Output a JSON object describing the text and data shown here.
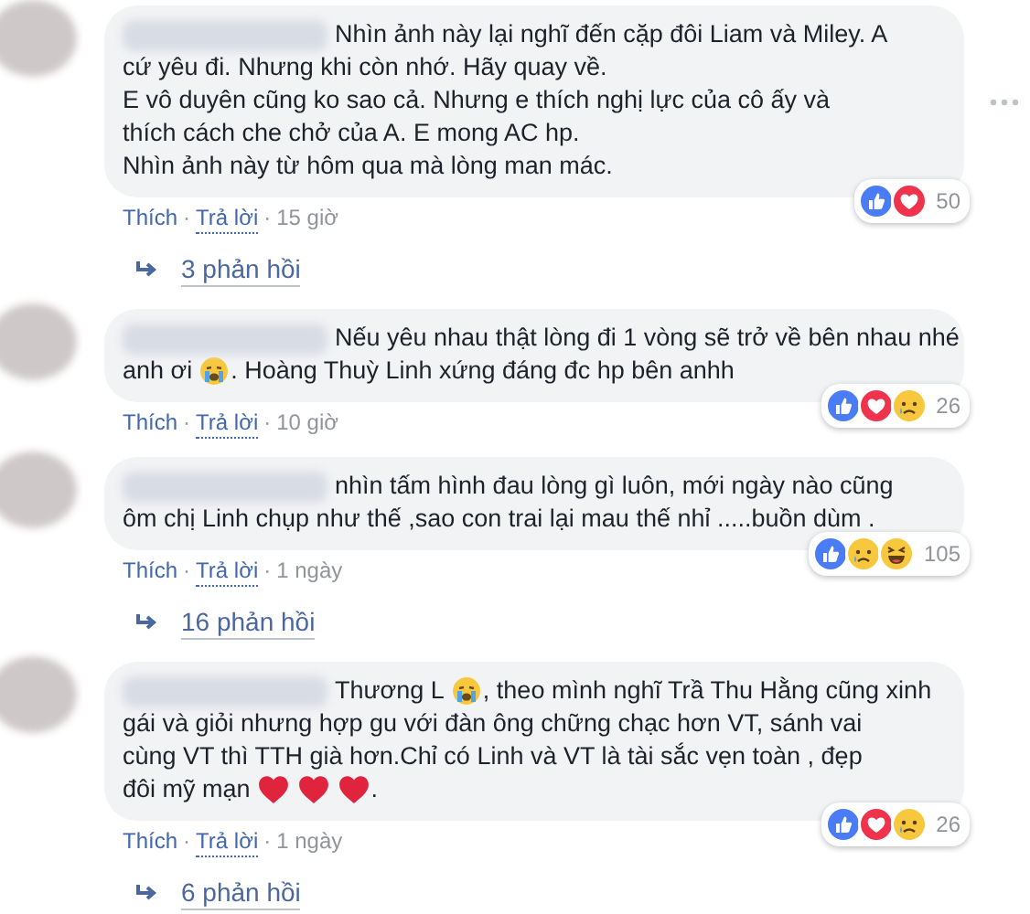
{
  "comments": [
    {
      "lines": [
        [
          {
            "kind": "text",
            "text": "Nhìn ảnh này lại nghĩ đến cặp đôi Liam và Miley. A"
          }
        ],
        [
          {
            "kind": "text",
            "text": "cứ yêu đi. Nhưng khi còn nhớ. Hãy quay về."
          }
        ],
        [
          {
            "kind": "text",
            "text": "E vô duyên cũng ko sao cả. Nhưng e thích nghị lực của cô ấy và"
          }
        ],
        [
          {
            "kind": "text",
            "text": "thích cách che chở của A. E mong AC hp."
          }
        ],
        [
          {
            "kind": "text",
            "text": "Nhìn ảnh này từ hôm qua mà lòng man mác."
          }
        ]
      ],
      "menu_visible": true,
      "reactions": [
        {
          "kind": "like"
        },
        {
          "kind": "love"
        }
      ],
      "reaction_count": "50",
      "actions": [
        {
          "kind": "like",
          "text": "Thích"
        },
        {
          "kind": "dot",
          "text": "·"
        },
        {
          "kind": "reply",
          "text": "Trả lời"
        },
        {
          "kind": "dot",
          "text": "·"
        },
        {
          "kind": "time",
          "text": "15 giờ"
        }
      ],
      "replies": "3 phản hồi"
    },
    {
      "lines": [
        [
          {
            "kind": "text",
            "text": "Nếu yêu nhau thật lòng đi 1 vòng sẽ trở về bên nhau nhé"
          }
        ],
        [
          {
            "kind": "text",
            "text": "anh ơi"
          },
          {
            "kind": "crying"
          },
          {
            "kind": "text",
            "text": ". Hoàng Thuỳ Linh xứng đáng đc hp bên anhh"
          }
        ]
      ],
      "reactions": [
        {
          "kind": "like"
        },
        {
          "kind": "love"
        },
        {
          "kind": "sad"
        }
      ],
      "reaction_count": "26",
      "actions": [
        {
          "kind": "like",
          "text": "Thích"
        },
        {
          "kind": "dot",
          "text": "·"
        },
        {
          "kind": "reply",
          "text": "Trả lời"
        },
        {
          "kind": "dot",
          "text": "·"
        },
        {
          "kind": "time",
          "text": "10 giờ"
        }
      ]
    },
    {
      "lines": [
        [
          {
            "kind": "text",
            "text": "nhìn tấm hình đau lòng gì luôn, mới ngày nào cũng"
          }
        ],
        [
          {
            "kind": "text",
            "text": "ôm chị Linh chụp như thế ,sao con trai lại mau thế nhỉ .....buồn dùm ."
          }
        ]
      ],
      "reactions": [
        {
          "kind": "like"
        },
        {
          "kind": "sad"
        },
        {
          "kind": "haha"
        }
      ],
      "reaction_count": "105",
      "actions": [
        {
          "kind": "like",
          "text": "Thích"
        },
        {
          "kind": "dot",
          "text": "·"
        },
        {
          "kind": "reply",
          "text": "Trả lời"
        },
        {
          "kind": "dot",
          "text": "·"
        },
        {
          "kind": "time",
          "text": "1 ngày"
        }
      ],
      "replies": "16 phản hồi"
    },
    {
      "lines": [
        [
          {
            "kind": "text",
            "text": "Thương L"
          },
          {
            "kind": "crying"
          },
          {
            "kind": "text",
            "text": ", theo mình nghĩ Trầ Thu Hằng cũng xinh"
          }
        ],
        [
          {
            "kind": "text",
            "text": "gái và giỏi nhưng hợp gu với đàn ông chững chạc hơn VT, sánh vai"
          }
        ],
        [
          {
            "kind": "text",
            "text": "cùng VT thì TTH già hơn.Chỉ có Linh và VT là tài sắc vẹn toàn , đẹp"
          }
        ],
        [
          {
            "kind": "text",
            "text": "đôi mỹ mạn"
          },
          {
            "kind": "heart"
          },
          {
            "kind": "heart"
          },
          {
            "kind": "heart"
          },
          {
            "kind": "text",
            "text": "."
          }
        ]
      ],
      "reactions": [
        {
          "kind": "like"
        },
        {
          "kind": "love"
        },
        {
          "kind": "sad"
        }
      ],
      "reaction_count": "26",
      "actions": [
        {
          "kind": "like",
          "text": "Thích"
        },
        {
          "kind": "dot",
          "text": "·"
        },
        {
          "kind": "reply",
          "text": "Trả lời"
        },
        {
          "kind": "dot",
          "text": "·"
        },
        {
          "kind": "time",
          "text": "1 ngày"
        }
      ],
      "replies": "6 phản hồi"
    }
  ]
}
